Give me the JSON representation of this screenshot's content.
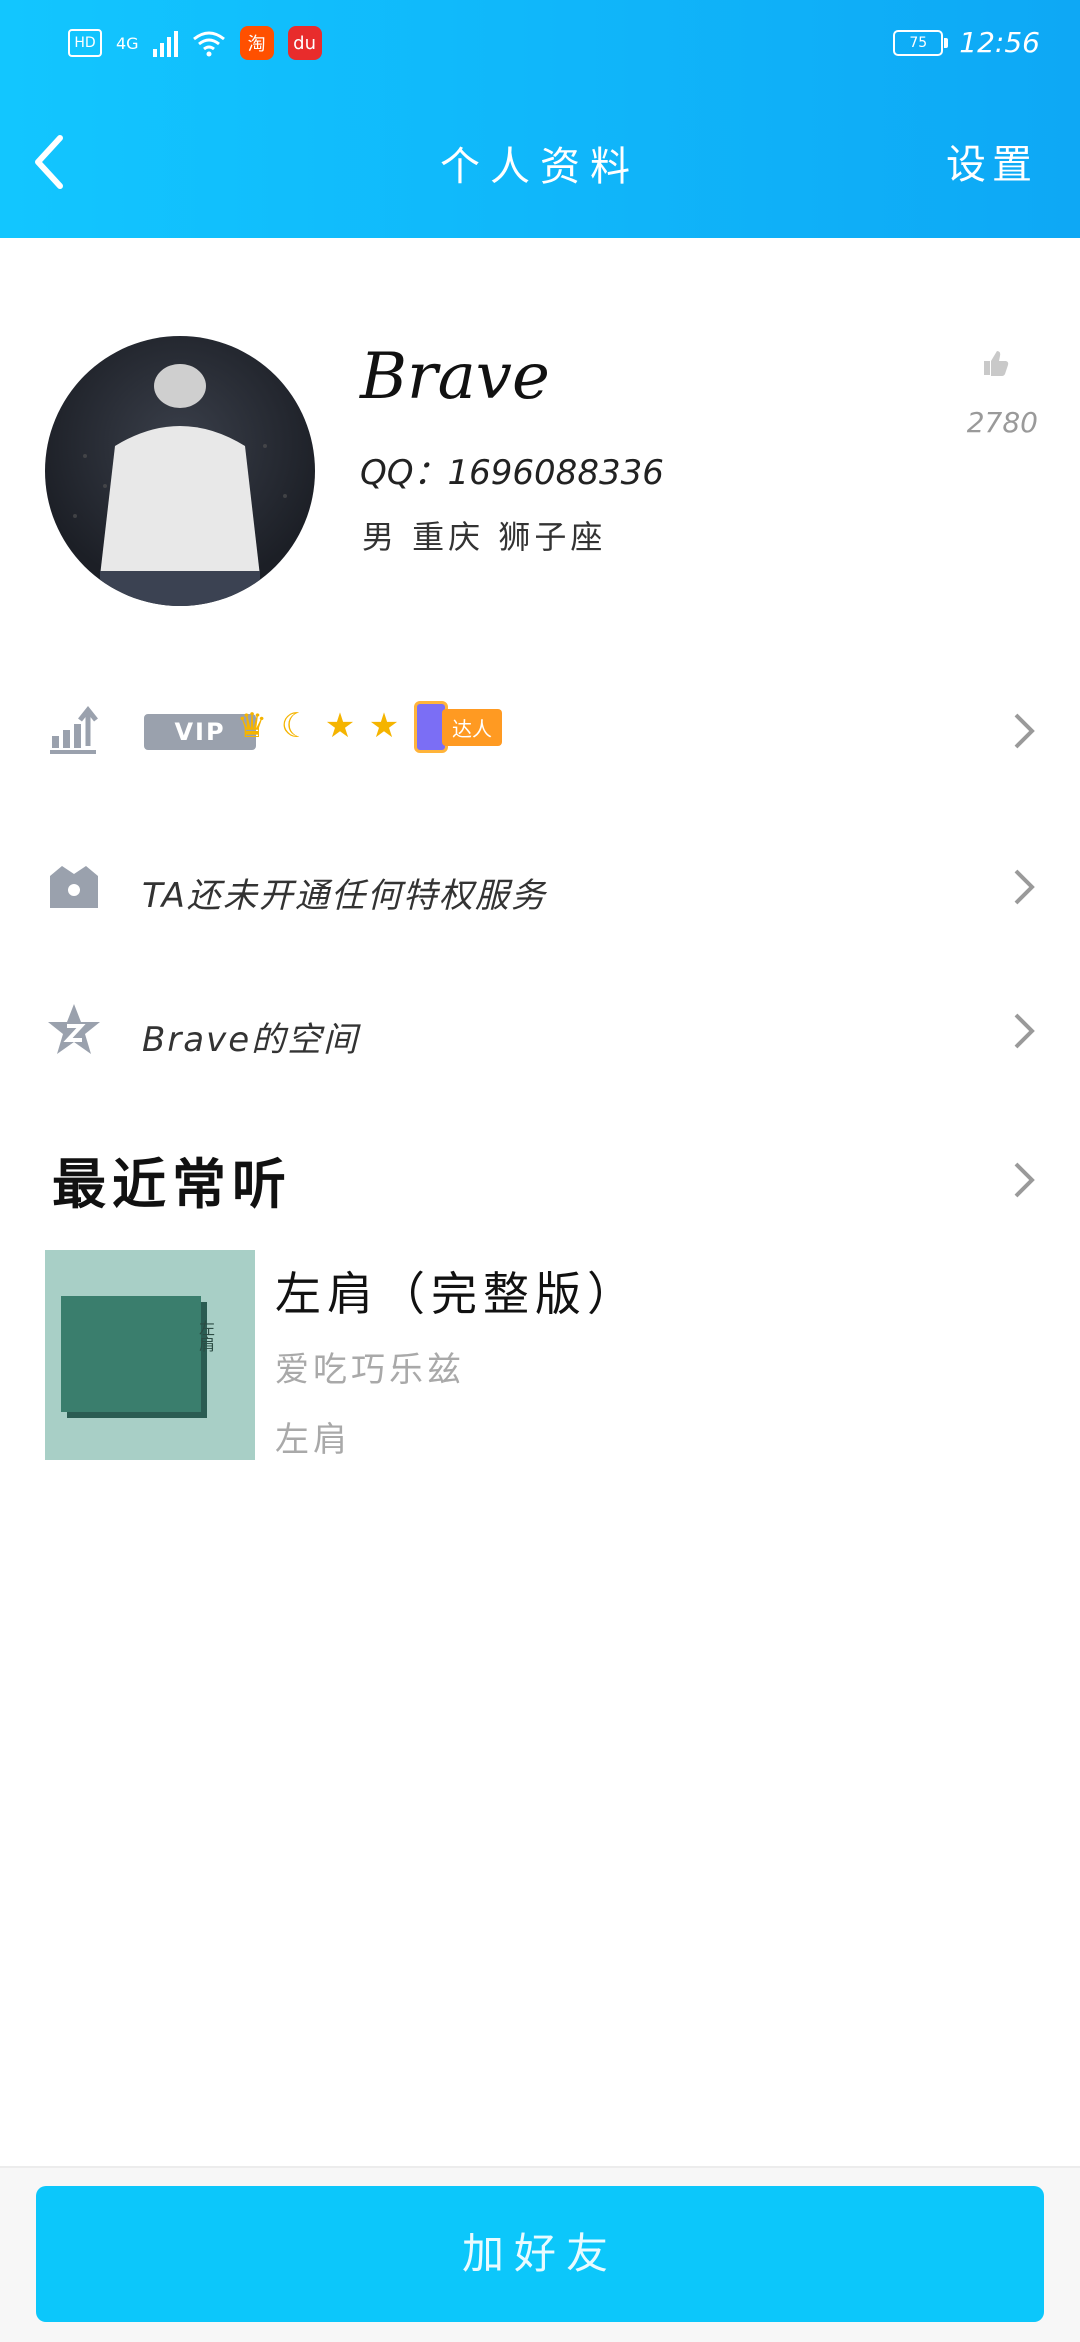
{
  "status_bar": {
    "hd": "HD",
    "network": "4G",
    "battery": "75",
    "time": "12:56",
    "apps": [
      {
        "icon": "taobao-icon",
        "label": "淘"
      },
      {
        "icon": "baidu-icon",
        "label": "du"
      }
    ]
  },
  "nav": {
    "title": "个人资料",
    "settings": "设置"
  },
  "profile": {
    "name": "Brave",
    "qq": "QQ：1696088336",
    "info": "男 重庆 狮子座",
    "like_count": "2780"
  },
  "rows": {
    "vip": {
      "vip_label": "VIP",
      "daren_label": "达人"
    },
    "privilege": {
      "text": "TA还未开通任何特权服务"
    },
    "space": {
      "text": "Brave的空间"
    }
  },
  "recent": {
    "title": "最近常听",
    "song": {
      "title": "左肩（完整版）",
      "artist": "爱吃巧乐兹",
      "album": "左肩",
      "cover_text": "左肩"
    }
  },
  "bottom": {
    "add_friend": "加好友"
  },
  "colors": {
    "header_start": "#12c6ff",
    "header_end": "#0ea8f5",
    "button": "#0cc7fb",
    "icon_gray": "#9aa1ad"
  }
}
